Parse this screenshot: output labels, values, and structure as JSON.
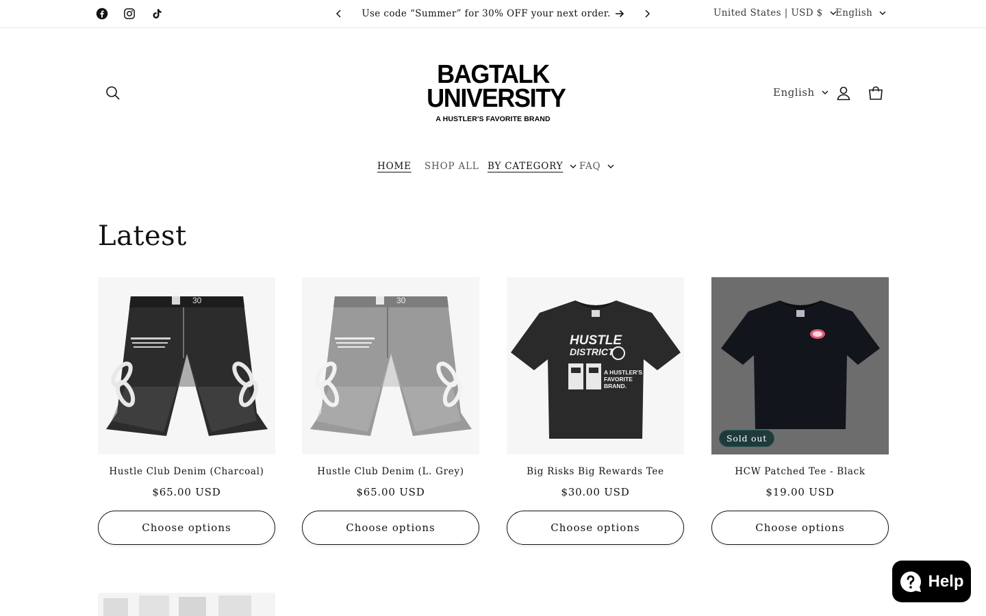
{
  "announcement": {
    "text": "Use code “Summer” for 30% OFF your next order.",
    "country_selector": "United States | USD $",
    "language_selector": "English"
  },
  "social": [
    "facebook-icon",
    "instagram-icon",
    "tiktok-icon"
  ],
  "header": {
    "logo_line1": "BAGTALK",
    "logo_line2": "UNIVERSITY",
    "logo_tagline": "A HUSTLER'S FAVORITE BRAND",
    "language": "English"
  },
  "nav": {
    "items": [
      {
        "label": "HOME"
      },
      {
        "label": "SHOP ALL"
      },
      {
        "label": "BY CATEGORY"
      },
      {
        "label": "FAQ"
      }
    ]
  },
  "section": {
    "title": "Latest"
  },
  "products": [
    {
      "title": "Hustle Club Denim (Charcoal)",
      "price": "$65.00 USD",
      "button": "Choose options",
      "size_tag": "30"
    },
    {
      "title": "Hustle Club Denim (L. Grey)",
      "price": "$65.00 USD",
      "button": "Choose options",
      "size_tag": "30"
    },
    {
      "title": "Big Risks Big Rewards Tee",
      "price": "$30.00 USD",
      "button": "Choose options",
      "print_line1": "HUSTLE",
      "print_line2": "DISTRICT",
      "print_line3": "A HUSTLER'S",
      "print_line4": "FAVORITE",
      "print_line5": "BRAND."
    },
    {
      "title": "HCW Patched Tee - Black",
      "price": "$19.00 USD",
      "button": "Choose options",
      "badge": "Sold out"
    }
  ],
  "help_button": "Help",
  "colors": {
    "text": "#121212",
    "badge_bg": "#1e3a3a",
    "sold_out_overlay": "#6d6d6d",
    "help_bg": "#000000"
  }
}
